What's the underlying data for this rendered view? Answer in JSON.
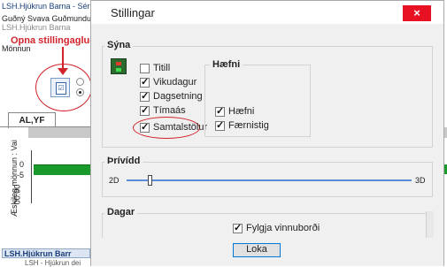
{
  "background": {
    "title": "LSH.Hjúkrun Barna - Sérha",
    "person": "Guðný Svava Guðmundu",
    "sub": "LSH.Hjúkrun Barna",
    "monnun_label": "Mönnun",
    "callout": "Opna stillingaglugga",
    "tab_label": "AL,YF",
    "vertical_label": "Æskileg mönnun : Vai",
    "tick_0": "0",
    "tick_neg5": "-5",
    "tick_time": "00:00",
    "bottom_tab": "LSH.Hjúkrun Barr",
    "bottom_sub": "LSH - Hjúkrun dei"
  },
  "dialog": {
    "title": "Stillingar",
    "close_glyph": "×",
    "syna": {
      "label": "Sýna",
      "checkboxes": [
        {
          "label": "Titill",
          "checked": false
        },
        {
          "label": "Vikudagur",
          "checked": true
        },
        {
          "label": "Dagsetning",
          "checked": true
        },
        {
          "label": "Tímaás",
          "checked": true
        },
        {
          "label": "Samtalstölur",
          "checked": true
        }
      ],
      "haefni": {
        "label": "Hæfni",
        "checkboxes": [
          {
            "label": "Hæfni",
            "checked": true
          },
          {
            "label": "Færnistig",
            "checked": true
          }
        ]
      }
    },
    "thrivitt": {
      "label": "Þrívídd",
      "min_label": "2D",
      "max_label": "3D",
      "value": 0.08
    },
    "dagar": {
      "label": "Dagar",
      "checkbox": {
        "label": "Fylgja vinnuborði",
        "checked": true
      }
    },
    "close_button": "Loka"
  },
  "colors": {
    "accent_red": "#d0232a",
    "close_red": "#e81123",
    "slider_blue": "#5a8cd8",
    "green": "#1a9a2a"
  }
}
